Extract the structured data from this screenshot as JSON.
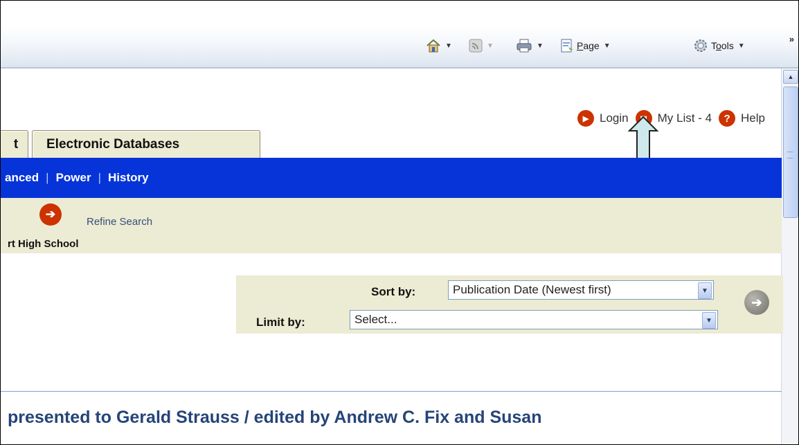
{
  "toolbar": {
    "chevron": "»",
    "items": [
      {
        "icon": "home-icon",
        "label": ""
      },
      {
        "icon": "feeds-icon",
        "label": ""
      },
      {
        "icon": "print-icon",
        "label": ""
      },
      {
        "icon": "page-icon",
        "label": "Page",
        "underline": "P"
      },
      {
        "icon": "tools-icon",
        "label": "Tools",
        "underline": "o"
      }
    ]
  },
  "top_links": {
    "login": "Login",
    "my_list": "My List - 4",
    "help": "Help"
  },
  "tabs": {
    "partial": "t",
    "electronic_databases": "Electronic Databases"
  },
  "search_nav": {
    "advanced_partial": "anced",
    "sep": "|",
    "power": "Power",
    "history": "History"
  },
  "refine": {
    "refine_search": "Refine Search",
    "school": "rt High School"
  },
  "sort": {
    "sort_label": "Sort by:",
    "sort_value": "Publication Date (Newest first)",
    "limit_label": "Limit by:",
    "limit_value": "Select..."
  },
  "result": {
    "title": "presented to Gerald Strauss / edited by Andrew C. Fix and Susan"
  },
  "colors": {
    "nav_blue": "#0634d8",
    "beige": "#ecebd3",
    "accent_red": "#cc3300",
    "title_blue": "#264478"
  }
}
